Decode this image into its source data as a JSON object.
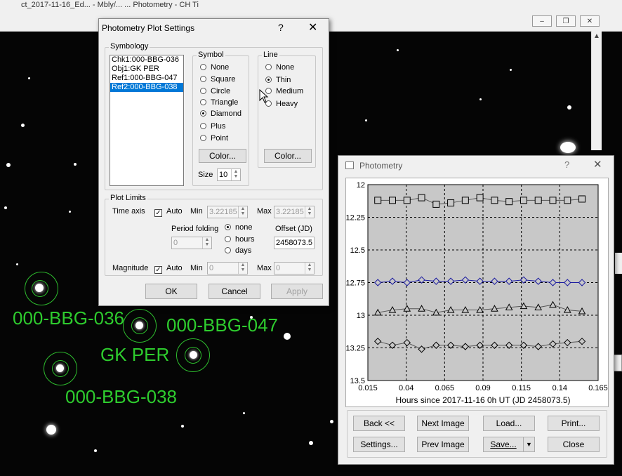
{
  "window": {
    "title_text": "ct_2017-11-16_Ed... - Mbly/... ... Photometry - CH Ti"
  },
  "star_labels": [
    "000-BBG-036",
    "000-BBG-047",
    "GK PER",
    "000-BBG-038"
  ],
  "settings": {
    "title": "Photometry Plot Settings",
    "help_label": "?",
    "close_label": "✕",
    "symbology_label": "Symbology",
    "stars": [
      "Chk1:000-BBG-036",
      "Obj1:GK PER",
      "Ref1:000-BBG-047",
      "Ref2:000-BBG-038"
    ],
    "selected_star": "Ref2:000-BBG-038",
    "symbol_label": "Symbol",
    "symbols": [
      "None",
      "Square",
      "Circle",
      "Triangle",
      "Diamond",
      "Plus",
      "Point"
    ],
    "symbol_selected": "Diamond",
    "symbol_color_label": "Color...",
    "size_label": "Size",
    "size_value": "10",
    "line_label": "Line",
    "lines": [
      "None",
      "Thin",
      "Medium",
      "Heavy"
    ],
    "line_selected": "Thin",
    "line_color_label": "Color...",
    "plot_limits_label": "Plot Limits",
    "time_axis_label": "Time axis",
    "auto_label": "Auto",
    "min_label": "Min",
    "max_label": "Max",
    "time_min": "3.22185",
    "time_max": "3.22185",
    "period_folding_label": "Period folding",
    "period_value": "0",
    "fold_options": [
      "none",
      "hours",
      "days"
    ],
    "fold_selected": "none",
    "offset_label": "Offset (JD)",
    "offset_value": "2458073.5",
    "magnitude_label": "Magnitude",
    "mag_min": "0",
    "mag_max": "0",
    "ok_label": "OK",
    "cancel_label": "Cancel",
    "apply_label": "Apply"
  },
  "photometry": {
    "title": "Photometry",
    "help_label": "?",
    "close_label": "✕",
    "buttons": {
      "back": "Back <<",
      "next_image": "Next Image",
      "load": "Load...",
      "print": "Print...",
      "settings": "Settings...",
      "prev_image": "Prev Image",
      "save": "Save...",
      "close": "Close"
    }
  },
  "chart_data": {
    "type": "line",
    "xlabel": "Hours since 2017-11-16 0h UT (JD 2458073.5)",
    "ylabel": "",
    "xlim": [
      0.015,
      0.165
    ],
    "ylim": [
      12,
      13.5
    ],
    "y_inverted": true,
    "xticks": [
      "0.015",
      "0.04",
      "0.065",
      "0.09",
      "0.115",
      "0.14",
      "0.165"
    ],
    "yticks": [
      "12",
      "12.25",
      "12.5",
      "12.75",
      "13",
      "13.25",
      "13.5"
    ],
    "grid": true,
    "x": [
      0.0215,
      0.031,
      0.0405,
      0.05,
      0.0595,
      0.069,
      0.0785,
      0.088,
      0.0975,
      0.107,
      0.1165,
      0.126,
      0.1355,
      0.145,
      0.1545
    ],
    "series": [
      {
        "symbol": "square",
        "color": "#000000",
        "values": [
          12.12,
          12.12,
          12.12,
          12.1,
          12.15,
          12.14,
          12.12,
          12.1,
          12.12,
          12.13,
          12.12,
          12.12,
          12.12,
          12.12,
          12.11
        ]
      },
      {
        "symbol": "diamond",
        "color": "#1a1aa0",
        "values": [
          12.75,
          12.74,
          12.75,
          12.73,
          12.74,
          12.74,
          12.73,
          12.74,
          12.74,
          12.74,
          12.73,
          12.74,
          12.75,
          12.75,
          12.75
        ]
      },
      {
        "symbol": "triangle",
        "color": "#000000",
        "values": [
          12.98,
          12.96,
          12.95,
          12.95,
          12.98,
          12.96,
          12.96,
          12.96,
          12.95,
          12.94,
          12.93,
          12.94,
          12.92,
          12.96,
          12.97
        ]
      },
      {
        "symbol": "diamond",
        "color": "#000000",
        "values": [
          13.2,
          13.23,
          13.21,
          13.26,
          13.23,
          13.23,
          13.24,
          13.23,
          13.23,
          13.23,
          13.23,
          13.24,
          13.22,
          13.21,
          13.2
        ]
      }
    ]
  }
}
